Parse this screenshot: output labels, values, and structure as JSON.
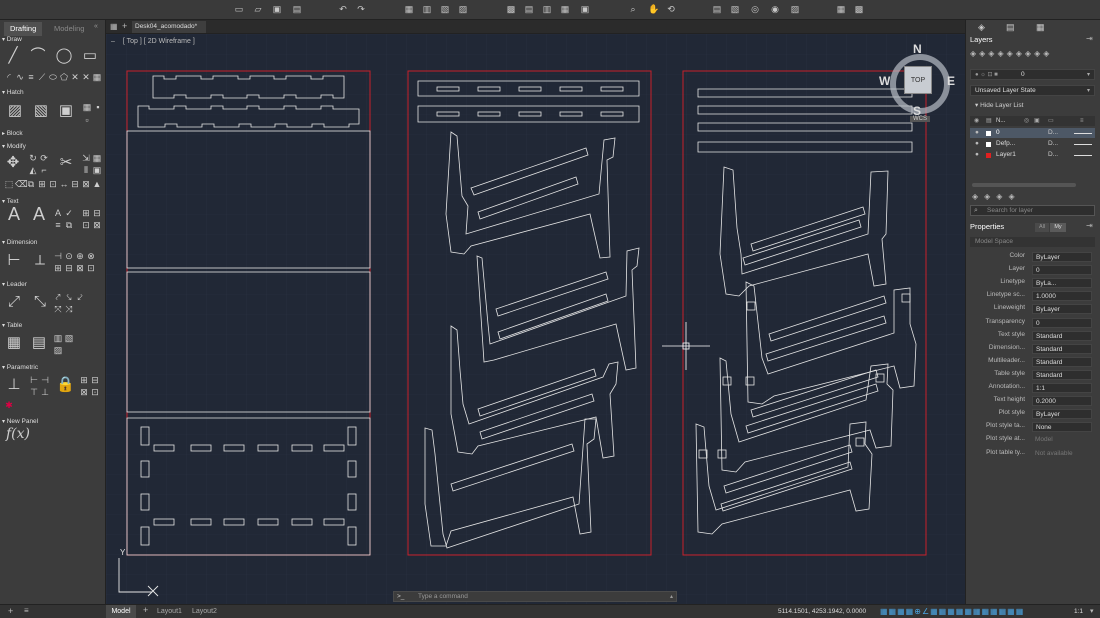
{
  "left_tabs": [
    "Drafting",
    "Modeling"
  ],
  "doc_tab": "Desk04_acomodado*",
  "viewport": {
    "view": "Top",
    "style": "2D Wireframe"
  },
  "left_sections": [
    "Draw",
    "Hatch",
    "Block",
    "Modify",
    "Text",
    "Dimension",
    "Leader",
    "Table",
    "Parametric",
    "New Panel"
  ],
  "viewcube": {
    "n": "N",
    "s": "S",
    "e": "E",
    "w": "W",
    "top": "TOP",
    "wcs": "WCS"
  },
  "right": {
    "layers_title": "Layers",
    "layer_current": "0",
    "layer_state": "Unsaved Layer State",
    "hide_list": "Hide Layer List",
    "layers": [
      {
        "name": "0",
        "d": "D...",
        "color": "#ffffff"
      },
      {
        "name": "Defp...",
        "d": "D...",
        "color": "#ffffff"
      },
      {
        "name": "Layer1",
        "d": "D...",
        "color": "#e02020"
      }
    ],
    "col_name": "N...",
    "search_placeholder": "Search for layer",
    "props_title": "Properties",
    "props_tabs": [
      "All",
      "My"
    ],
    "model_space": "Model Space",
    "props": [
      {
        "label": "Color",
        "value": "ByLayer"
      },
      {
        "label": "Layer",
        "value": "0"
      },
      {
        "label": "Linetype",
        "value": "ByLa..."
      },
      {
        "label": "Linetype sc...",
        "value": "1.0000"
      },
      {
        "label": "Lineweight",
        "value": "ByLayer"
      },
      {
        "label": "Transparency",
        "value": "0"
      },
      {
        "label": "Text style",
        "value": "Standard"
      },
      {
        "label": "Dimension...",
        "value": "Standard"
      },
      {
        "label": "Multileader...",
        "value": "Standard"
      },
      {
        "label": "Table style",
        "value": "Standard"
      },
      {
        "label": "Annotation...",
        "value": "1:1"
      },
      {
        "label": "Text height",
        "value": "0.2000"
      },
      {
        "label": "Plot style",
        "value": "ByLayer"
      },
      {
        "label": "Plot style ta...",
        "value": "None"
      },
      {
        "label": "Plot style at...",
        "value": "Model"
      },
      {
        "label": "Plot table ty...",
        "value": "Not available"
      }
    ]
  },
  "command_placeholder": "Type a command",
  "command_prompt": ">_",
  "layout_tabs": [
    "Model",
    "Layout1",
    "Layout2"
  ],
  "coords": "5114.1501, 4253.1942, 0.0000",
  "scale": "1:1",
  "ucs": {
    "x": "X",
    "y": "Y"
  }
}
